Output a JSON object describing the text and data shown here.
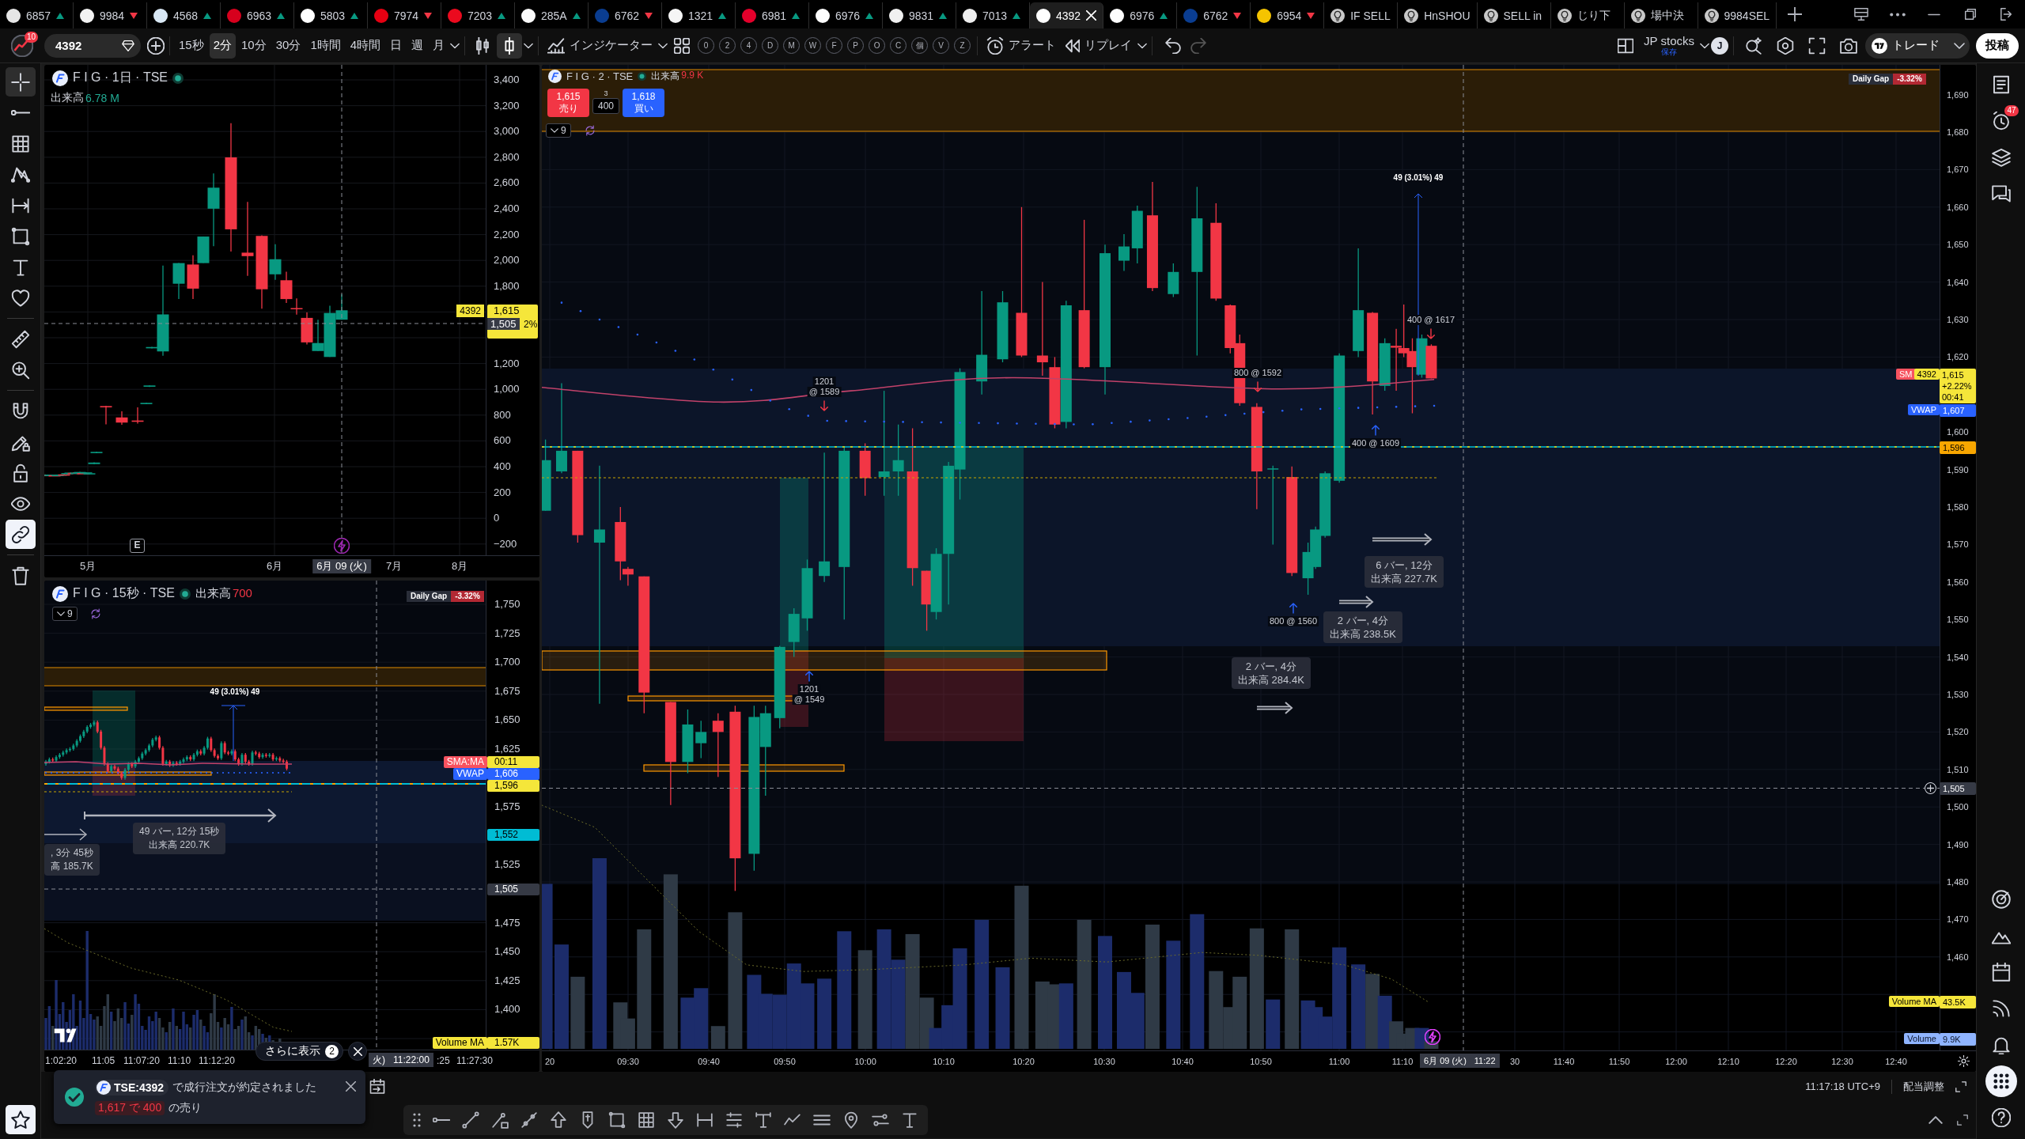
{
  "tabs": [
    {
      "kind": "symbol",
      "label": "6857",
      "color": "#e6e6e6",
      "rising": true,
      "selected": false
    },
    {
      "kind": "symbol",
      "label": "9984",
      "color": "#f2f2f2",
      "rising": false,
      "selected": false
    },
    {
      "kind": "symbol",
      "label": "4568",
      "color": "#d9e8f5",
      "rising": true,
      "selected": false
    },
    {
      "kind": "symbol",
      "label": "6963",
      "color": "#d7001d",
      "rising": true,
      "selected": false
    },
    {
      "kind": "symbol",
      "label": "5803",
      "color": "#ffffff",
      "rising": true,
      "selected": false
    },
    {
      "kind": "symbol",
      "label": "7974",
      "color": "#e60012",
      "rising": false,
      "selected": false
    },
    {
      "kind": "symbol",
      "label": "7203",
      "color": "#eb0a1e",
      "rising": true,
      "selected": false
    },
    {
      "kind": "symbol",
      "label": "285A",
      "color": "#fafafa",
      "rising": true,
      "selected": false
    },
    {
      "kind": "symbol",
      "label": "6762",
      "color": "#0a3d91",
      "rising": false,
      "selected": false
    },
    {
      "kind": "symbol",
      "label": "1321",
      "color": "#f5f5f5",
      "rising": true,
      "selected": false
    },
    {
      "kind": "symbol",
      "label": "6981",
      "color": "#e4002b",
      "rising": true,
      "selected": false
    },
    {
      "kind": "symbol",
      "label": "6976",
      "color": "#fdfdfd",
      "rising": true,
      "selected": false
    },
    {
      "kind": "symbol",
      "label": "9831",
      "color": "#f0f0f0",
      "rising": true,
      "selected": false
    },
    {
      "kind": "symbol",
      "label": "7013",
      "color": "#eeeeee",
      "rising": true,
      "selected": false
    },
    {
      "kind": "symbol",
      "label": "4392",
      "color": "#ffffff",
      "selected": true
    },
    {
      "kind": "symbol",
      "label": "6976",
      "color": "#fdfdfd",
      "rising": true,
      "selected": false
    },
    {
      "kind": "symbol",
      "label": "6762",
      "color": "#0a3d91",
      "rising": false,
      "selected": false
    },
    {
      "kind": "symbol",
      "label": "6954",
      "color": "#f5c400",
      "rising": false,
      "selected": false
    },
    {
      "kind": "alert",
      "label": "IF SELL",
      "selected": false
    },
    {
      "kind": "alert",
      "label": "HnSHOU",
      "selected": false
    },
    {
      "kind": "alert",
      "label": "SELL in",
      "selected": false
    },
    {
      "kind": "alert",
      "label": "じり下",
      "selected": false
    },
    {
      "kind": "alert",
      "label": "場中決",
      "selected": false
    },
    {
      "kind": "alert",
      "label": "9984SEL",
      "selected": false
    }
  ],
  "toolbar": {
    "notifications": "10",
    "symbol": "4392",
    "intervals": [
      {
        "label": "15秒",
        "selected": false
      },
      {
        "label": "2分",
        "selected": true
      },
      {
        "label": "10分",
        "selected": false
      },
      {
        "label": "30分",
        "selected": false
      },
      {
        "label": "1時間",
        "selected": false
      },
      {
        "label": "4時間",
        "selected": false
      },
      {
        "label": "日",
        "selected": false
      },
      {
        "label": "週",
        "selected": false
      },
      {
        "label": "月",
        "selected": false
      }
    ],
    "chart_types": [
      {
        "kind": "candles",
        "selected": false
      },
      {
        "kind": "hollow-candle",
        "selected": true
      }
    ],
    "indicators": "インジケーター",
    "quick_buttons": [
      "0",
      "2",
      "4",
      "D",
      "M",
      "W",
      "F",
      "P",
      "O",
      "C",
      "個",
      "V",
      "Z"
    ],
    "alert": "アラート",
    "replay": "リプレイ",
    "layout_name": "JP stocks",
    "layout_status": "保存",
    "user_initial": "J",
    "trade": "トレード",
    "publish": "投稿"
  },
  "left_toolbar": {
    "groups": [
      [
        {
          "kind": "crosshair",
          "selected": true,
          "on": false
        },
        {
          "kind": "trend-line",
          "selected": false,
          "on": false
        },
        {
          "kind": "fib-grid",
          "selected": false,
          "on": false
        },
        {
          "kind": "pattern",
          "selected": false,
          "on": false
        },
        {
          "kind": "projection",
          "selected": false,
          "on": false
        },
        {
          "kind": "rectangle",
          "selected": false,
          "on": false
        },
        {
          "kind": "text",
          "selected": false,
          "on": false
        },
        {
          "kind": "favorites",
          "selected": false,
          "on": false
        }
      ],
      [
        {
          "kind": "ruler",
          "selected": false,
          "on": false
        },
        {
          "kind": "zoom",
          "selected": false,
          "on": false
        }
      ],
      [
        {
          "kind": "magnet",
          "selected": false,
          "on": false
        },
        {
          "kind": "drawing-lock",
          "selected": false,
          "on": false
        },
        {
          "kind": "lock",
          "selected": false,
          "on": false
        },
        {
          "kind": "visibility",
          "selected": false,
          "on": false
        },
        {
          "kind": "sync",
          "selected": false,
          "on": true
        }
      ],
      [
        {
          "kind": "trash",
          "selected": false,
          "on": false
        }
      ]
    ],
    "bottom": [
      {
        "kind": "star",
        "on": true
      }
    ]
  },
  "right_toolbar": {
    "groups": [
      [
        {
          "kind": "watchlist",
          "selected": false
        },
        {
          "kind": "alerts",
          "selected": false,
          "badge": "47"
        },
        {
          "kind": "layers",
          "selected": false
        },
        {
          "kind": "chat",
          "selected": false
        }
      ],
      [
        {
          "kind": "target",
          "selected": false
        },
        {
          "kind": "peaks",
          "selected": false
        },
        {
          "kind": "calendar",
          "selected": false
        },
        {
          "kind": "signal",
          "selected": false
        },
        {
          "kind": "bell",
          "selected": false
        },
        {
          "kind": "apps",
          "selected": true
        },
        {
          "kind": "help",
          "selected": false
        }
      ]
    ]
  },
  "daily_chart": {
    "title": "F I G · 1日 · TSE",
    "volume_label": "出来高",
    "volume": "6.78 M",
    "price_axis": [
      "3,400",
      "3,200",
      "3,000",
      "2,800",
      "2,600",
      "2,400",
      "2,200",
      "2,000",
      "1,800",
      "1,200",
      "1,000",
      "800",
      "600",
      "400",
      "200",
      "0",
      "−200"
    ],
    "symbol_tag": "4392",
    "last_price": "1,615",
    "crosshair_price": "1,505",
    "change_fragment": "2%",
    "earnings_marker": "E",
    "time_axis": [
      "5月",
      "6月",
      "7月",
      "8月"
    ],
    "crosshair_date": "6月 09 (火)"
  },
  "tick_chart": {
    "title": "F I G · 15秒 · TSE",
    "volume_label": "出来高",
    "volume": "700",
    "daily_gap_label": "Daily Gap",
    "daily_gap": "-3.32%",
    "bars_back": "9",
    "price_axis": [
      "1,750",
      "1,725",
      "1,700",
      "1,675",
      "1,650",
      "1,625",
      "1,575",
      "1,525",
      "1,475",
      "1,450",
      "1,425",
      "1,400"
    ],
    "price_tags": [
      {
        "kind": "sma",
        "label": "SMA:MA",
        "value": "00:11"
      },
      {
        "kind": "vwap",
        "label": "VWAP",
        "value": "1,606"
      },
      {
        "kind": "last",
        "value": "1,596"
      },
      {
        "kind": "level",
        "value": "1,552"
      },
      {
        "kind": "crosshair",
        "value": "1,505"
      },
      {
        "kind": "volume-ma",
        "label": "Volume MA",
        "value": "1.57K"
      }
    ],
    "measure_label": "49 (3.01%) 49",
    "ranges": [
      {
        "lines": [
          "49 バー, 12分 15秒",
          "出来高 220.7K"
        ]
      },
      {
        "lines": [
          ", 3分 45秒",
          "高 185.7K"
        ]
      }
    ],
    "time_axis": [
      "1:02:20",
      "11:05",
      "11:07:20",
      "11:10",
      "11:12:20",
      ":25",
      "11:27:30"
    ],
    "crosshair_time": [
      "火)",
      "11:22:00"
    ]
  },
  "main_chart": {
    "title": "F I G · 2 · TSE",
    "volume_label": "出来高",
    "volume": "9.9 K",
    "order_panel": {
      "sell_price": "1,615",
      "sell_label": "売り",
      "spread": "3",
      "quantity": "400",
      "buy_price": "1,618",
      "buy_label": "買い"
    },
    "bars_back": "9",
    "daily_gap_label": "Daily Gap",
    "daily_gap": "-3.32%",
    "price_axis": [
      "1,690",
      "1,680",
      "1,670",
      "1,660",
      "1,650",
      "1,640",
      "1,630",
      "1,620",
      "1,600",
      "1,590",
      "1,580",
      "1,570",
      "1,560",
      "1,550",
      "1,540",
      "1,530",
      "1,520",
      "1,510",
      "1,500",
      "1,490",
      "1,480",
      "1,470",
      "1,460"
    ],
    "price_tags": [
      {
        "kind": "sma",
        "label": "SM"
      },
      {
        "kind": "symbol",
        "label": "4392"
      },
      {
        "kind": "last",
        "lines": [
          "1,615",
          "+2.22%",
          "00:41"
        ]
      },
      {
        "kind": "vwap",
        "label": "VWAP",
        "value": "1,607"
      },
      {
        "kind": "line",
        "value": "1,596"
      },
      {
        "kind": "crosshair",
        "value": "1,505"
      },
      {
        "kind": "volume-ma",
        "label": "Volume MA",
        "value": "43.5K"
      },
      {
        "kind": "volume",
        "label": "Volume",
        "value": "9.9K"
      }
    ],
    "trade_marks": [
      {
        "kind": "sell",
        "lines": [
          "1201",
          "@ 1589"
        ]
      },
      {
        "kind": "sell",
        "lines": [
          "800 @ 1592"
        ]
      },
      {
        "kind": "sell",
        "lines": [
          "400 @ 1617"
        ]
      },
      {
        "kind": "buy",
        "lines": [
          "400 @ 1609"
        ]
      },
      {
        "kind": "buy",
        "lines": [
          "800 @ 1560"
        ]
      },
      {
        "kind": "buy",
        "lines": [
          "1201",
          "@ 1549"
        ]
      }
    ],
    "measure_label": "49 (3.01%) 49",
    "ranges": [
      {
        "lines": [
          "6 バー, 12分",
          "出来高 227.7K"
        ]
      },
      {
        "lines": [
          "2 バー, 4分",
          "出来高 238.5K"
        ]
      },
      {
        "lines": [
          "2 バー, 4分",
          "出来高 284.4K"
        ]
      }
    ],
    "time_axis": [
      "20",
      "09:30",
      "09:40",
      "09:50",
      "10:00",
      "10:10",
      "10:20",
      "10:30",
      "10:40",
      "10:50",
      "11:00",
      "11:10",
      "30",
      "11:40",
      "11:50",
      "12:00",
      "12:10",
      "12:20",
      "12:30",
      "12:40"
    ],
    "crosshair_time": [
      "6月 09 (火)",
      "11:22"
    ]
  },
  "notification": {
    "more_label": "さらに表示",
    "more_count": "2",
    "symbol": "TSE:4392",
    "message": "で成行注文が約定されました",
    "order": "1,617 で 400",
    "side": "の売り"
  },
  "status_bar": {
    "clock": "11:17:18 UTC+9",
    "adjustment": "配当調整"
  }
}
